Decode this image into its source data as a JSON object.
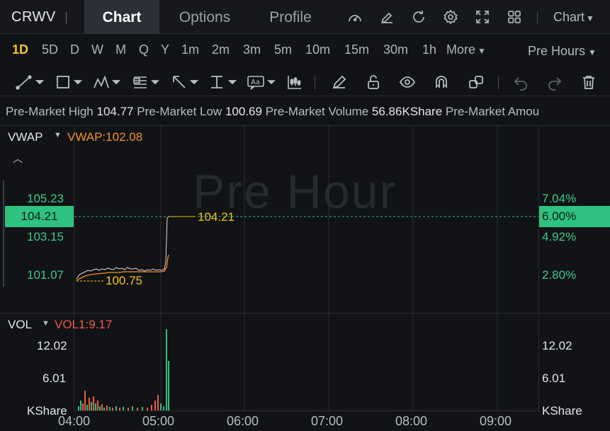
{
  "header": {
    "ticker": "CRWV",
    "tabs": [
      {
        "label": "Chart",
        "active": true
      },
      {
        "label": "Options",
        "active": false
      },
      {
        "label": "Profile",
        "active": false
      }
    ],
    "chart_dropdown": "Chart",
    "icons": [
      "speedometer-icon",
      "edit-icon",
      "refresh-icon",
      "gear-icon",
      "expand-icon",
      "grid-icon"
    ]
  },
  "intervals": {
    "items": [
      "1D",
      "5D",
      "D",
      "W",
      "M",
      "Q",
      "Y",
      "1m",
      "2m",
      "3m",
      "5m",
      "10m",
      "15m",
      "30m",
      "1h",
      "More"
    ],
    "active": "1D",
    "session": "Pre Hours"
  },
  "info_bar": {
    "high_label": "Pre-Market High",
    "high": "104.77",
    "low_label": "Pre-Market Low",
    "low": "100.69",
    "volume_label": "Pre-Market Volume",
    "volume": "56.86KShare",
    "amount_label": "Pre-Market Amou"
  },
  "main_chart": {
    "indicator": "VWAP",
    "indicator_value": "VWAP:102.08",
    "watermark": "Pre Hour",
    "left_axis": [
      "105.23",
      "104.21",
      "103.15",
      "101.07"
    ],
    "right_axis": [
      "7.04%",
      "6.00%",
      "4.92%",
      "2.80%"
    ],
    "last_price": "104.21",
    "low_marker": "100.75",
    "colors": {
      "price": "#d9d9d9",
      "vwap": "#f0902a",
      "up": "#2ec27e",
      "down": "#ef5a4a",
      "marker": "#f2c21b"
    }
  },
  "volume_chart": {
    "indicator": "VOL",
    "indicator_value": "VOL1:9.17",
    "left_axis": [
      "12.02",
      "6.01",
      "KShare"
    ],
    "right_axis": [
      "12.02",
      "6.01",
      "KShare"
    ]
  },
  "x_axis": [
    "04:00",
    "05:00",
    "06:00",
    "07:00",
    "08:00",
    "09:00"
  ]
}
